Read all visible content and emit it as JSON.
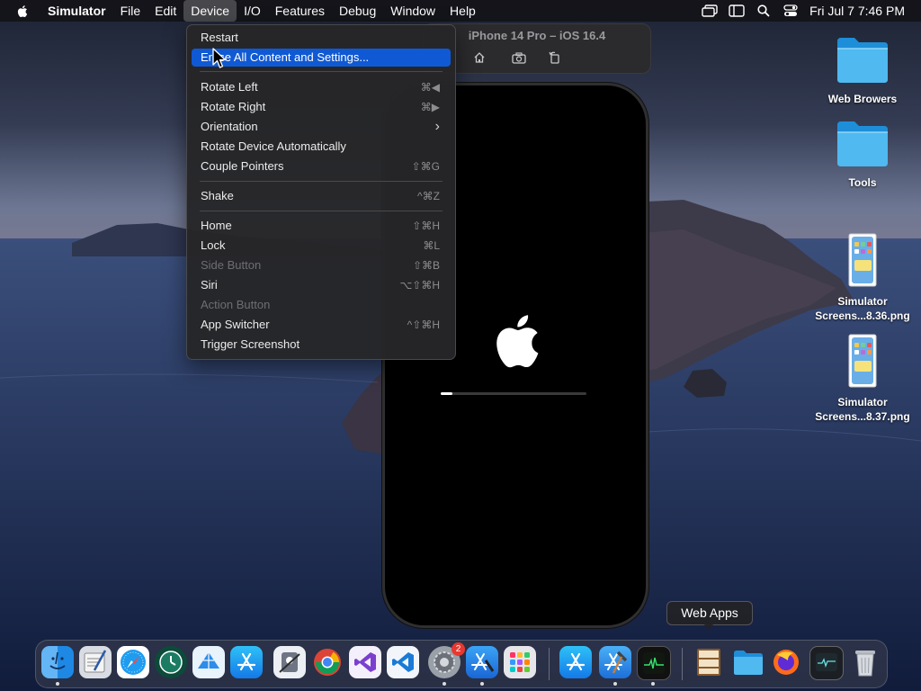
{
  "menubar": {
    "items": [
      "Simulator",
      "File",
      "Edit",
      "Device",
      "I/O",
      "Features",
      "Debug",
      "Window",
      "Help"
    ],
    "active_item": "Device",
    "clock": "Fri Jul 7  7:46 PM"
  },
  "simulator_window": {
    "title": "iPhone 14 Pro – iOS 16.4"
  },
  "boot_progress": 0.08,
  "device_menu": {
    "items": [
      {
        "label": "Restart",
        "shortcut": ""
      },
      {
        "label": "Erase All Content and Settings...",
        "shortcut": ""
      },
      {
        "label": "Rotate Left",
        "shortcut": "⌘◀"
      },
      {
        "label": "Rotate Right",
        "shortcut": "⌘▶"
      },
      {
        "label": "Orientation",
        "shortcut": "›"
      },
      {
        "label": "Rotate Device Automatically",
        "shortcut": ""
      },
      {
        "label": "Couple Pointers",
        "shortcut": "⇧⌘G"
      },
      {
        "label": "Shake",
        "shortcut": "^⌘Z"
      },
      {
        "label": "Home",
        "shortcut": "⇧⌘H"
      },
      {
        "label": "Lock",
        "shortcut": "⌘L"
      },
      {
        "label": "Side Button",
        "shortcut": "⇧⌘B"
      },
      {
        "label": "Siri",
        "shortcut": "⌥⇧⌘H"
      },
      {
        "label": "Action Button",
        "shortcut": ""
      },
      {
        "label": "App Switcher",
        "shortcut": "^⇧⌘H"
      },
      {
        "label": "Trigger Screenshot",
        "shortcut": ""
      }
    ],
    "highlighted": "Erase All Content and Settings...",
    "disabled": [
      "Side Button",
      "Action Button"
    ]
  },
  "desktop": {
    "icons": [
      {
        "label": "Web Browers",
        "icon": "folder-icon"
      },
      {
        "label": "Tools",
        "icon": "folder-icon"
      },
      {
        "label_line1": "Simulator",
        "label_line2": "Screens...8.36.png",
        "icon": "screenshot-file-icon"
      },
      {
        "label_line1": "Simulator",
        "label_line2": "Screens...8.37.png",
        "icon": "screenshot-file-icon"
      }
    ]
  },
  "dock": {
    "tooltip": "Web Apps",
    "finder_badge": "2",
    "apps": [
      "finder",
      "script-editor",
      "safari",
      "time-machine",
      "network-radar",
      "app-store",
      "system-information",
      "chrome",
      "visual-studio",
      "vscode",
      "system-preferences",
      "instruments",
      "launchpad",
      "app-store",
      "xcode",
      "activity-monitor",
      "archive-utility",
      "folder",
      "firefox",
      "console",
      "trash"
    ]
  },
  "colors": {
    "menu_highlight": "#1059d4",
    "menu_bg": "#262628",
    "dock_bg": "#3c404e"
  }
}
